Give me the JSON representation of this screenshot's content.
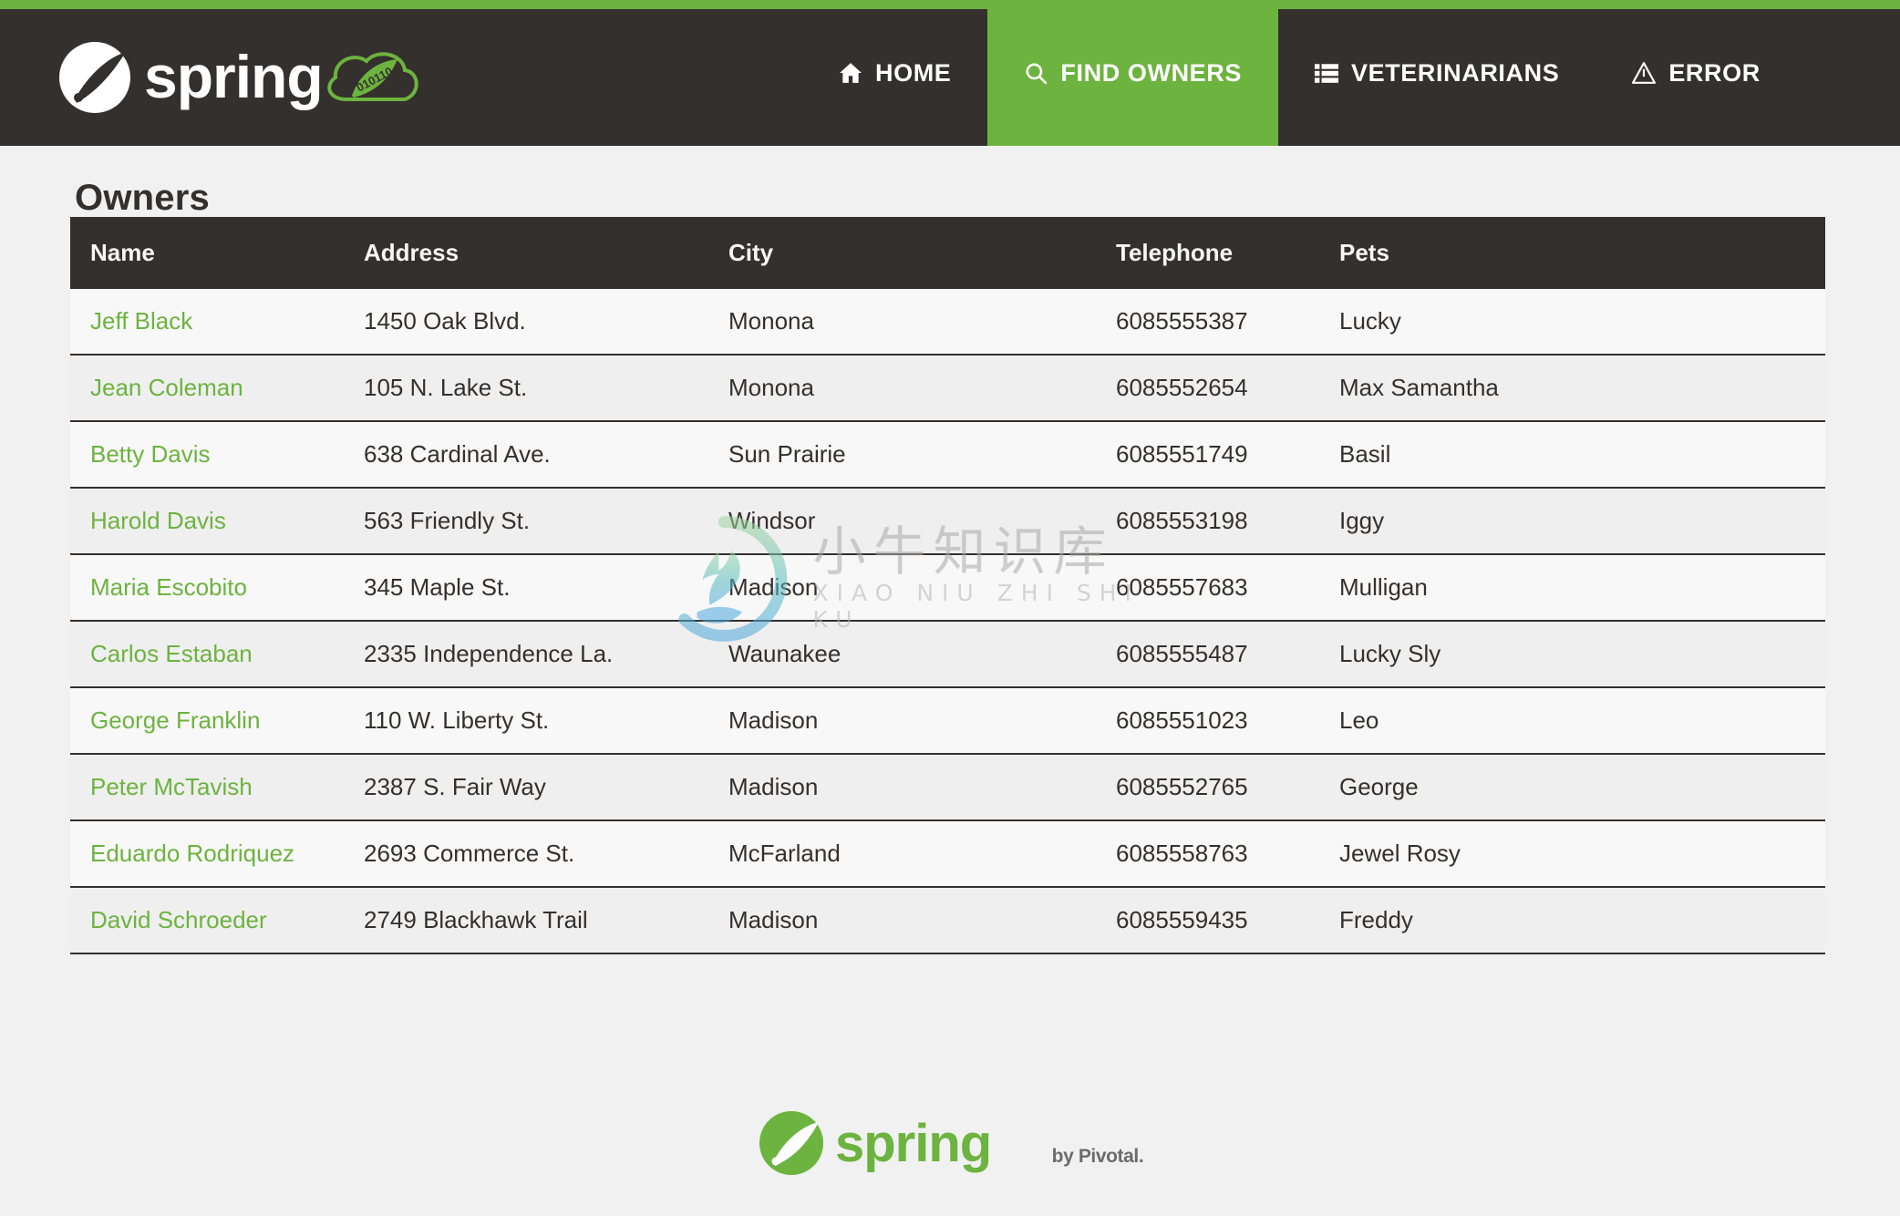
{
  "theme": {
    "accent_green": "#6db33f",
    "dark": "#34302d",
    "page_bg": "#f1f1f1",
    "row_odd": "#f8f8f8",
    "row_even": "#efefef"
  },
  "navbar": {
    "brand_text": "spring",
    "brand_icon": "spring-leaf-logo",
    "cloud_badge_text": "010110",
    "items": [
      {
        "label": "HOME",
        "icon": "home-icon",
        "active": false
      },
      {
        "label": "FIND OWNERS",
        "icon": "search-icon",
        "active": true
      },
      {
        "label": "VETERINARIANS",
        "icon": "list-icon",
        "active": false
      },
      {
        "label": "ERROR",
        "icon": "warning-triangle-icon",
        "active": false
      }
    ]
  },
  "main": {
    "heading": "Owners",
    "table": {
      "columns": [
        "Name",
        "Address",
        "City",
        "Telephone",
        "Pets"
      ],
      "rows": [
        {
          "name": "Jeff Black",
          "address": "1450 Oak Blvd.",
          "city": "Monona",
          "telephone": "6085555387",
          "pets": "Lucky"
        },
        {
          "name": "Jean Coleman",
          "address": "105 N. Lake St.",
          "city": "Monona",
          "telephone": "6085552654",
          "pets": "Max Samantha"
        },
        {
          "name": "Betty Davis",
          "address": "638 Cardinal Ave.",
          "city": "Sun Prairie",
          "telephone": "6085551749",
          "pets": "Basil"
        },
        {
          "name": "Harold Davis",
          "address": "563 Friendly St.",
          "city": "Windsor",
          "telephone": "6085553198",
          "pets": "Iggy"
        },
        {
          "name": "Maria Escobito",
          "address": "345 Maple St.",
          "city": "Madison",
          "telephone": "6085557683",
          "pets": "Mulligan"
        },
        {
          "name": "Carlos Estaban",
          "address": "2335 Independence La.",
          "city": "Waunakee",
          "telephone": "6085555487",
          "pets": "Lucky Sly"
        },
        {
          "name": "George Franklin",
          "address": "110 W. Liberty St.",
          "city": "Madison",
          "telephone": "6085551023",
          "pets": "Leo"
        },
        {
          "name": "Peter McTavish",
          "address": "2387 S. Fair Way",
          "city": "Madison",
          "telephone": "6085552765",
          "pets": "George"
        },
        {
          "name": "Eduardo Rodriquez",
          "address": "2693 Commerce St.",
          "city": "McFarland",
          "telephone": "6085558763",
          "pets": "Jewel Rosy"
        },
        {
          "name": "David Schroeder",
          "address": "2749 Blackhawk Trail",
          "city": "Madison",
          "telephone": "6085559435",
          "pets": "Freddy"
        }
      ]
    }
  },
  "footer": {
    "logo_text": "spring",
    "logo_icon": "spring-leaf-logo",
    "byline": "by Pivotal."
  },
  "watermark": {
    "icon": "xiaoniu-deer-circle-logo",
    "chinese": "小牛知识库",
    "pinyin": "XIAO NIU ZHI SHI KU"
  }
}
